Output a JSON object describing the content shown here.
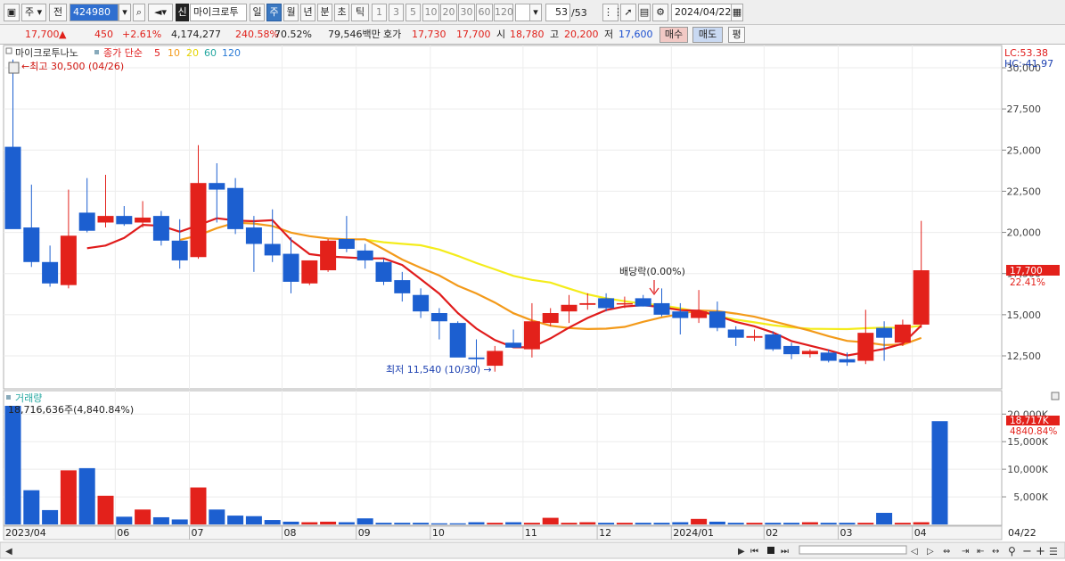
{
  "toolbar": {
    "market": "주",
    "prev": "전",
    "code": "424980",
    "stock_name": "마이크로투",
    "new_label": "신",
    "periods": [
      "일",
      "주",
      "월",
      "년",
      "분",
      "초",
      "틱"
    ],
    "selected_period": "주",
    "intervals": [
      "1",
      "3",
      "5",
      "10",
      "20",
      "30",
      "60",
      "120"
    ],
    "count": "53",
    "count_total": "/53",
    "date": "2024/04/22"
  },
  "quote": {
    "price": "17,700",
    "arrow": "▲",
    "change": "450",
    "change_pct": "+2.61%",
    "volume": "4,174,277",
    "volume_pct": "240.58%",
    "turnover_pct": "70.52%",
    "amount": "79,546백만",
    "ask_label": "호가",
    "ask": "17,730",
    "bid": "17,700",
    "open_label": "시",
    "open": "18,780",
    "high_label": "고",
    "high": "20,200",
    "low_label": "저",
    "low": "17,600",
    "buy_button": "매수",
    "sell_button": "매도",
    "avg_button": "평"
  },
  "colors": {
    "up": "#e3211b",
    "down": "#1c5fd0",
    "ma5": "#e01c1c",
    "ma10": "#f39a1a",
    "ma20": "#f4ec1b",
    "ma60": "#23a7a0",
    "ma120": "#2a7bd6"
  },
  "chart_data": [
    {
      "type": "candlestick",
      "legend_name": "마이크로투나노",
      "ma_label": "종가 단순",
      "ma_periods": [
        "5",
        "10",
        "20",
        "60",
        "120"
      ],
      "ylim": [
        10000,
        30500
      ],
      "y_ticks": [
        "30,000",
        "27,500",
        "25,000",
        "22,500",
        "20,000",
        "17,500",
        "15,000",
        "12,500"
      ],
      "lc_label": "LC:53.38",
      "hc_label": "HC:-41.97",
      "max_label": "최고 30,500 (04/26)",
      "min_label": "최저 11,540 (10/30)",
      "dividend_label": "배당락(0.00%)",
      "last_price_label": "17,700",
      "last_pct_label": "22.41%",
      "candles": [
        {
          "o": 25200,
          "h": 30500,
          "l": 20800,
          "c": 20200
        },
        {
          "o": 20300,
          "h": 22900,
          "l": 17900,
          "c": 18200
        },
        {
          "o": 18200,
          "h": 19200,
          "l": 16700,
          "c": 16900
        },
        {
          "o": 16800,
          "h": 22600,
          "l": 16600,
          "c": 19800
        },
        {
          "o": 21200,
          "h": 23300,
          "l": 20000,
          "c": 20100
        },
        {
          "o": 20600,
          "h": 23500,
          "l": 20300,
          "c": 21000
        },
        {
          "o": 21000,
          "h": 21600,
          "l": 20400,
          "c": 20500
        },
        {
          "o": 20600,
          "h": 21900,
          "l": 20300,
          "c": 20900
        },
        {
          "o": 21000,
          "h": 21300,
          "l": 19200,
          "c": 19500
        },
        {
          "o": 19500,
          "h": 20800,
          "l": 17800,
          "c": 18300
        },
        {
          "o": 18500,
          "h": 25300,
          "l": 18400,
          "c": 23000
        },
        {
          "o": 23000,
          "h": 24200,
          "l": 20600,
          "c": 22600
        },
        {
          "o": 22700,
          "h": 23300,
          "l": 19900,
          "c": 20200
        },
        {
          "o": 20300,
          "h": 21000,
          "l": 17600,
          "c": 19300
        },
        {
          "o": 19300,
          "h": 21400,
          "l": 18200,
          "c": 18600
        },
        {
          "o": 18700,
          "h": 19700,
          "l": 16300,
          "c": 17000
        },
        {
          "o": 16900,
          "h": 18300,
          "l": 16800,
          "c": 18300
        },
        {
          "o": 17700,
          "h": 19600,
          "l": 17600,
          "c": 19500
        },
        {
          "o": 19600,
          "h": 21000,
          "l": 18800,
          "c": 19000
        },
        {
          "o": 18900,
          "h": 19300,
          "l": 17800,
          "c": 18300
        },
        {
          "o": 18200,
          "h": 18400,
          "l": 16800,
          "c": 17000
        },
        {
          "o": 17100,
          "h": 17600,
          "l": 15800,
          "c": 16300
        },
        {
          "o": 16200,
          "h": 16600,
          "l": 14800,
          "c": 15200
        },
        {
          "o": 15100,
          "h": 15400,
          "l": 13500,
          "c": 14600
        },
        {
          "o": 14500,
          "h": 14600,
          "l": 12500,
          "c": 12400
        },
        {
          "o": 12400,
          "h": 13500,
          "l": 11800,
          "c": 12300
        },
        {
          "o": 11900,
          "h": 13100,
          "l": 11540,
          "c": 12800
        },
        {
          "o": 13300,
          "h": 14100,
          "l": 13000,
          "c": 13000
        },
        {
          "o": 12900,
          "h": 15700,
          "l": 12400,
          "c": 14600
        },
        {
          "o": 14500,
          "h": 15400,
          "l": 14300,
          "c": 15100
        },
        {
          "o": 15200,
          "h": 16200,
          "l": 14500,
          "c": 15600
        },
        {
          "o": 15600,
          "h": 16300,
          "l": 15300,
          "c": 15700
        },
        {
          "o": 16000,
          "h": 16300,
          "l": 15200,
          "c": 15400
        },
        {
          "o": 15700,
          "h": 16100,
          "l": 15400,
          "c": 15700
        },
        {
          "o": 16000,
          "h": 16200,
          "l": 15500,
          "c": 15500
        },
        {
          "o": 15700,
          "h": 16600,
          "l": 14900,
          "c": 15000
        },
        {
          "o": 15200,
          "h": 15700,
          "l": 13800,
          "c": 14800
        },
        {
          "o": 14800,
          "h": 16500,
          "l": 14500,
          "c": 15200
        },
        {
          "o": 15200,
          "h": 15800,
          "l": 14000,
          "c": 14200
        },
        {
          "o": 14100,
          "h": 14300,
          "l": 13100,
          "c": 13600
        },
        {
          "o": 13600,
          "h": 14100,
          "l": 13400,
          "c": 13700
        },
        {
          "o": 13800,
          "h": 14000,
          "l": 12800,
          "c": 12900
        },
        {
          "o": 13100,
          "h": 13300,
          "l": 12300,
          "c": 12600
        },
        {
          "o": 12600,
          "h": 12900,
          "l": 12400,
          "c": 12800
        },
        {
          "o": 12700,
          "h": 12900,
          "l": 12100,
          "c": 12200
        },
        {
          "o": 12300,
          "h": 12700,
          "l": 11900,
          "c": 12100
        },
        {
          "o": 12200,
          "h": 15300,
          "l": 12000,
          "c": 13900
        },
        {
          "o": 14200,
          "h": 14600,
          "l": 12200,
          "c": 13600
        },
        {
          "o": 13300,
          "h": 14700,
          "l": 13100,
          "c": 14400
        },
        {
          "o": 14400,
          "h": 20700,
          "l": 14200,
          "c": 17700
        }
      ]
    },
    {
      "type": "bar",
      "legend_name": "거래량",
      "volume_label": "18,716,636주(4,840.84%)",
      "unit": "K",
      "ylim": [
        0,
        21500
      ],
      "y_ticks": [
        "20,000K",
        "15,000K",
        "10,000K",
        "5,000K"
      ],
      "last_volume_label": "18,717K",
      "last_volume_pct_label": "4840.84%",
      "values": [
        22000,
        6200,
        2600,
        9800,
        10200,
        5200,
        1400,
        2700,
        1300,
        900,
        6700,
        2700,
        1600,
        1500,
        800,
        500,
        400,
        500,
        400,
        1100,
        300,
        300,
        300,
        200,
        200,
        400,
        300,
        400,
        300,
        1200,
        300,
        400,
        300,
        300,
        300,
        300,
        400,
        1000,
        500,
        300,
        300,
        300,
        300,
        400,
        300,
        300,
        300,
        2100,
        300,
        400,
        18717
      ]
    }
  ],
  "x_axis": {
    "labels": [
      "2023/04",
      "06",
      "07",
      "08",
      "09",
      "10",
      "11",
      "12",
      "2024/01",
      "02",
      "03",
      "04"
    ],
    "right_label": "04/22"
  }
}
